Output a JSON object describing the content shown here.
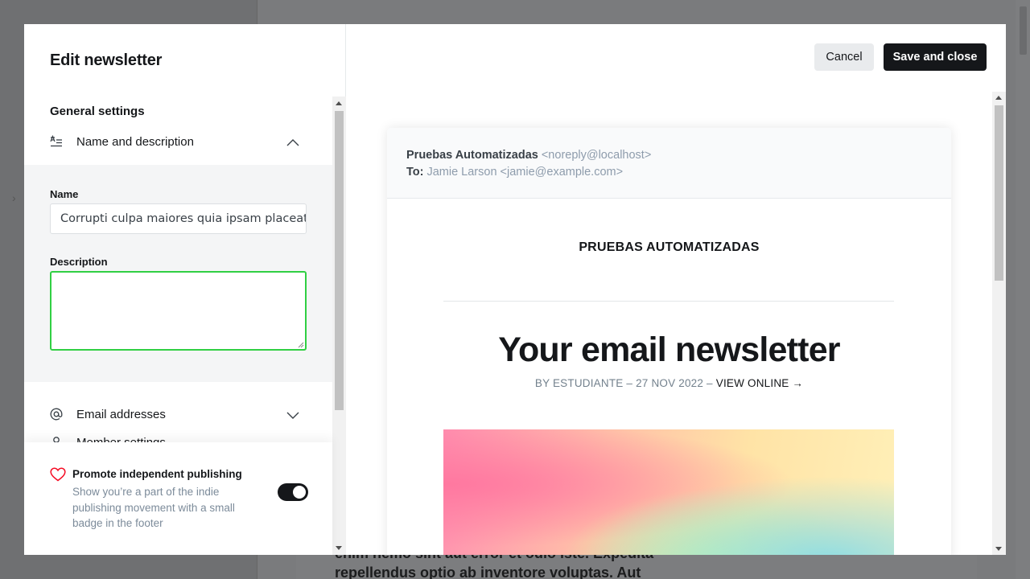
{
  "background": {
    "article_text": "enim nemo sint aut error et odio iste. Expedita repellendus optio ab inventore voluptas. Aut"
  },
  "modal": {
    "title": "Edit newsletter",
    "cancel_label": "Cancel",
    "save_label": "Save and close"
  },
  "settings": {
    "section_title": "General settings",
    "accordions": [
      {
        "label": "Name and description",
        "icon": "text-align-icon",
        "expanded": true
      },
      {
        "label": "Email addresses",
        "icon": "at-sign-icon",
        "expanded": false
      },
      {
        "label": "Member settings",
        "icon": "user-icon",
        "expanded": false
      }
    ],
    "name_label": "Name",
    "name_value": "Corrupti culpa maiores quia ipsam placeat",
    "description_label": "Description",
    "description_value": ""
  },
  "promo": {
    "title": "Promote independent publishing",
    "description": "Show you’re a part of the indie publishing movement with a small badge in the footer",
    "enabled": true,
    "accent": "#f50b23"
  },
  "preview": {
    "from_name": "Pruebas Automatizadas",
    "from_address": "<noreply@localhost>",
    "to_label": "To:",
    "to_value": "Jamie Larson <jamie@example.com>",
    "site_name": "PRUEBAS AUTOMATIZADAS",
    "post_title": "Your email newsletter",
    "byline": "BY ESTUDIANTE – 27 NOV 2022 –",
    "view_online": "VIEW ONLINE →"
  }
}
